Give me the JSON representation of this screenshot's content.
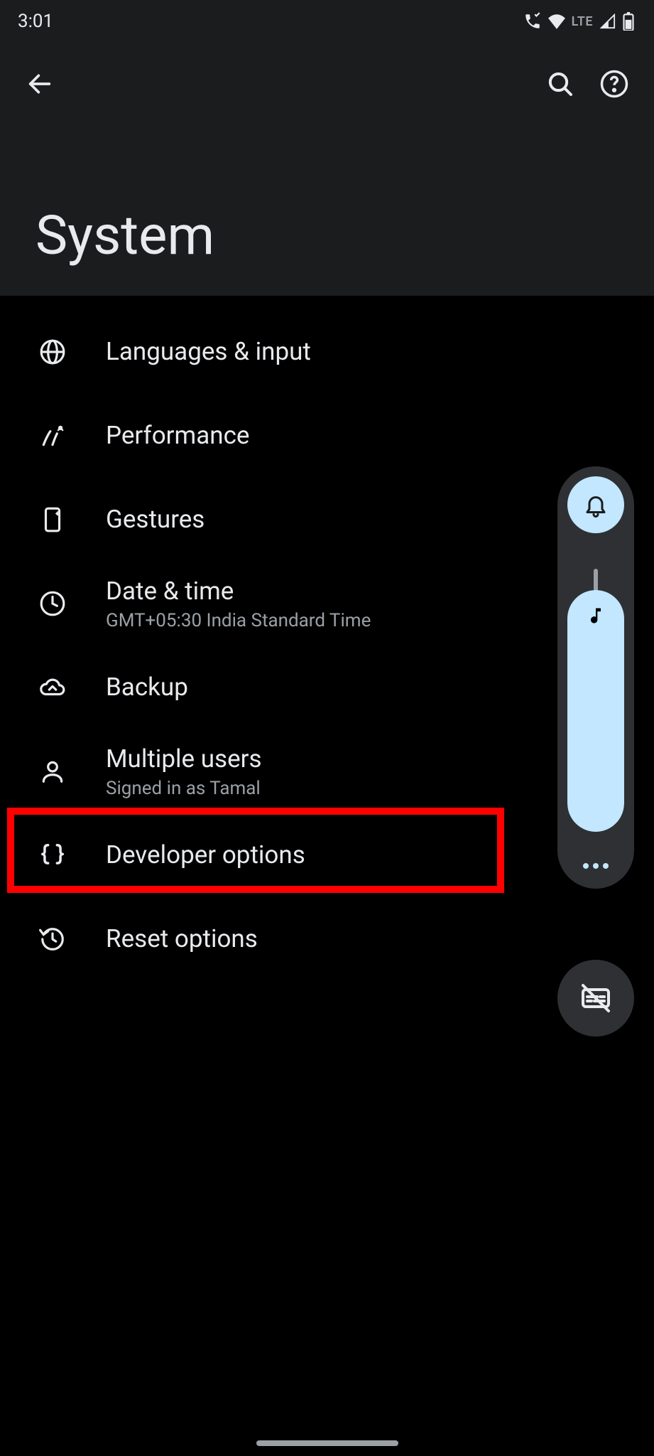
{
  "status": {
    "time": "3:01",
    "network_label": "LTE"
  },
  "page": {
    "title": "System"
  },
  "items": [
    {
      "title": "Languages & input",
      "subtitle": ""
    },
    {
      "title": "Performance",
      "subtitle": ""
    },
    {
      "title": "Gestures",
      "subtitle": ""
    },
    {
      "title": "Date & time",
      "subtitle": "GMT+05:30 India Standard Time"
    },
    {
      "title": "Backup",
      "subtitle": ""
    },
    {
      "title": "Multiple users",
      "subtitle": "Signed in as Tamal"
    },
    {
      "title": "Developer options",
      "subtitle": ""
    },
    {
      "title": "Reset options",
      "subtitle": ""
    }
  ],
  "highlight": {
    "index": 6
  }
}
